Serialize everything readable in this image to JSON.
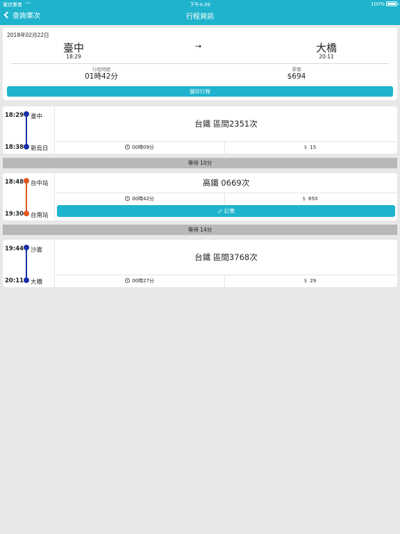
{
  "status_bar": {
    "carrier": "電信業者",
    "time": "下午4:39",
    "battery": "100%"
  },
  "nav": {
    "back_label": "查詢車次",
    "title": "行程資訊"
  },
  "summary": {
    "date": "2018年02月22日",
    "from": {
      "name": "臺中",
      "time": "18:29"
    },
    "to": {
      "name": "大橋",
      "time": "20:11"
    },
    "duration_label": "行程時間",
    "duration": "01時42分",
    "fare_label": "票價",
    "fare": "$694",
    "save_label": "儲存行程"
  },
  "legs": [
    {
      "dep_time": "18:29",
      "dep_station": "臺中",
      "arr_time": "18:38",
      "arr_station": "新烏日",
      "train": "台鐵 區間2351次",
      "duration": "00時09分",
      "price": "15",
      "line_color": "#1a2fa8"
    },
    {
      "dep_time": "18:48",
      "dep_station": "台中站",
      "arr_time": "19:30",
      "arr_station": "台南站",
      "train": "高鐵 0669次",
      "duration": "00時42分",
      "price": "650",
      "book_label": "訂票",
      "line_color": "#e0561f"
    },
    {
      "dep_time": "19:44",
      "dep_station": "沙崙",
      "arr_time": "20:11",
      "arr_station": "大橋",
      "train": "台鐵 區間3768次",
      "duration": "00時27分",
      "price": "29",
      "line_color": "#1a2fa8"
    }
  ],
  "waits": [
    "等待 10分",
    "等待 14分"
  ],
  "icons": {
    "back": "chevron-left-icon",
    "arrow": "arrow-right-icon",
    "clock": "clock-icon",
    "dollar": "dollar-icon",
    "ticket": "ticket-icon"
  },
  "colors": {
    "accent": "#1fb3cd",
    "tra_line": "#1a2fa8",
    "hsr_line": "#e0561f"
  }
}
